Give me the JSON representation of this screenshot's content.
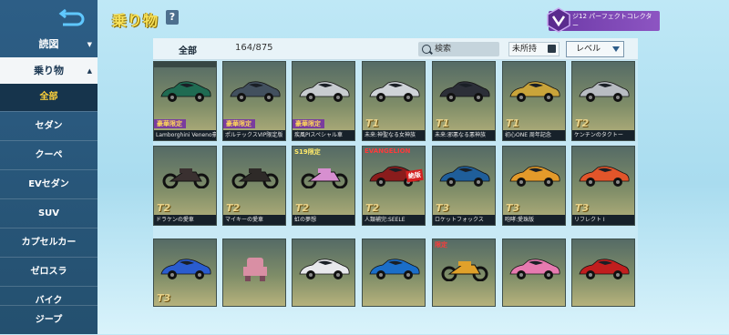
{
  "header": {
    "title": "乗り物",
    "help": "?",
    "banner_text": "ジ12 パーフェクトコレクター"
  },
  "sidebar": {
    "categories": [
      {
        "label": "読図"
      },
      {
        "label": "乗り物"
      }
    ],
    "sub_items": [
      "全部",
      "セダン",
      "クーペ",
      "EVセダン",
      "SUV",
      "カプセルカー",
      "ゼロスラ",
      "バイク",
      "ジープ"
    ]
  },
  "filters": {
    "tab_all": "全部",
    "count": "164/875",
    "search_placeholder": "検索",
    "unowned_label": "未所持",
    "sort_label": "レベル"
  },
  "colors": {
    "sidebar_bg": "#2d5e86",
    "title_yellow": "#f7e25b",
    "accent_yellow": "#ffd23a",
    "badge_purple": "#7a3c9e"
  },
  "cards": [
    {
      "name": "Lamborghini Veneno豪華限定",
      "badge": "豪華限定",
      "car_color": "#1f6b52",
      "type": "car",
      "topband": true
    },
    {
      "name": "ポルテックスVIP限定版",
      "badge": "豪華限定",
      "car_color": "#42505e",
      "type": "car"
    },
    {
      "name": "疾風PIスペシャル車",
      "badge": "豪華限定",
      "car_color": "#c8ccd0",
      "type": "car"
    },
    {
      "name": "未来:神聖なる女神族",
      "tier": "T1",
      "car_color": "#cfd3d8",
      "type": "car"
    },
    {
      "name": "未来:邪悪なる悪神族",
      "tier": "T1",
      "car_color": "#2c2f38",
      "type": "car"
    },
    {
      "name": "初心ONE 周年記念",
      "tier": "T1",
      "car_color": "#c9a43a",
      "type": "car"
    },
    {
      "name": "ケンチンのタクトー",
      "tier": "T2",
      "car_color": "#b8bcc2",
      "type": "car"
    },
    {
      "name": "ドラケンの愛車",
      "tier": "T2",
      "car_color": "#3a3030",
      "type": "bike"
    },
    {
      "name": "マイキーの愛車",
      "tier": "T2",
      "car_color": "#2e2a28",
      "type": "bike"
    },
    {
      "name": "虹の夢想",
      "tier": "T2",
      "logo": "S19限定",
      "car_color": "#d78fd0",
      "type": "bike"
    },
    {
      "name": "人類補完:SEELE",
      "tier": "T2",
      "logo": "EVANGELION",
      "sold": "絶版",
      "car_color": "#8a1c1c",
      "type": "car"
    },
    {
      "name": "ロケットフォックス",
      "tier": "T3",
      "car_color": "#1f5e9a",
      "type": "car"
    },
    {
      "name": "咆哮:愛珠版",
      "tier": "T3",
      "car_color": "#e39a2a",
      "type": "car"
    },
    {
      "name": "リフレクト Ⅰ",
      "tier": "T3",
      "car_color": "#e2552a",
      "type": "car"
    },
    {
      "name": "",
      "tier": "T3",
      "car_color": "#2a5ccf",
      "type": "car"
    },
    {
      "name": "",
      "car_color": "#d98fa4",
      "type": "robot"
    },
    {
      "name": "",
      "car_color": "#e8e8ec",
      "type": "car"
    },
    {
      "name": "",
      "car_color": "#1b6ec9",
      "type": "car"
    },
    {
      "name": "",
      "logo": "限定",
      "car_color": "#e0a12a",
      "type": "bike"
    },
    {
      "name": "",
      "car_color": "#e77ab0",
      "type": "car"
    },
    {
      "name": "",
      "car_color": "#c11e1e",
      "type": "car"
    }
  ]
}
